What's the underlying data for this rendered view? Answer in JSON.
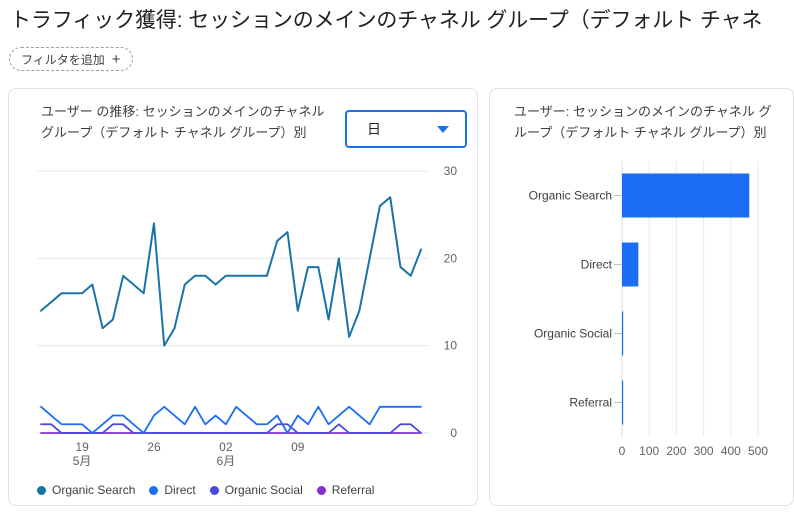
{
  "header": {
    "title": "トラフィック獲得: セッションのメインのチャネル グループ（デフォルト チャネ",
    "filter_chip_label": "フィルタを追加",
    "filter_chip_icon": "plus-icon"
  },
  "trend_card": {
    "title": "ユーザー の推移: セッションのメインのチャネル グループ（デフォルト チャネル グループ）別",
    "granularity": {
      "selected": "日",
      "icon": "chevron-down-icon"
    },
    "legend": [
      {
        "label": "Organic Search",
        "color": "#1a73a8"
      },
      {
        "label": "Direct",
        "color": "#1b6ef3"
      },
      {
        "label": "Organic Social",
        "color": "#4a46e0"
      },
      {
        "label": "Referral",
        "color": "#8430ce"
      }
    ]
  },
  "breakdown_card": {
    "title": "ユーザー: セッションのメインのチャネル グループ（デフォルト チャネル グループ）別"
  },
  "chart_data": [
    {
      "type": "line",
      "title": "ユーザー の推移: セッションのメインのチャネル グループ（デフォルト チャネル グループ）別",
      "xlabel": "",
      "ylabel": "",
      "ylim": [
        0,
        30
      ],
      "yticks": [
        0,
        10,
        20,
        30
      ],
      "grid": true,
      "legend_position": "bottom",
      "x_tick_labels": [
        {
          "index": 4,
          "line1": "19",
          "line2": "5月"
        },
        {
          "index": 11,
          "line1": "26",
          "line2": ""
        },
        {
          "index": 18,
          "line1": "02",
          "line2": "6月"
        },
        {
          "index": 25,
          "line1": "09",
          "line2": ""
        }
      ],
      "series": [
        {
          "name": "Organic Search",
          "color": "#1a73a8",
          "values": [
            14,
            15,
            16,
            16,
            16,
            17,
            12,
            13,
            18,
            17,
            16,
            24,
            10,
            12,
            17,
            18,
            18,
            17,
            18,
            18,
            18,
            18,
            18,
            22,
            23,
            14,
            19,
            19,
            13,
            20,
            11,
            14,
            20,
            26,
            27,
            19,
            18,
            21
          ]
        },
        {
          "name": "Direct",
          "color": "#1b6ef3",
          "values": [
            3,
            2,
            1,
            1,
            1,
            0,
            1,
            2,
            2,
            1,
            0,
            2,
            3,
            2,
            1,
            3,
            1,
            2,
            1,
            3,
            2,
            1,
            1,
            2,
            0,
            2,
            1,
            3,
            1,
            2,
            3,
            2,
            1,
            3,
            3,
            3,
            3,
            3
          ]
        },
        {
          "name": "Organic Social",
          "color": "#4a46e0",
          "values": [
            1,
            1,
            0,
            0,
            0,
            0,
            0,
            1,
            1,
            0,
            0,
            0,
            0,
            0,
            0,
            0,
            0,
            0,
            0,
            0,
            0,
            0,
            0,
            1,
            1,
            0,
            0,
            0,
            0,
            1,
            0,
            0,
            0,
            0,
            0,
            1,
            1,
            0
          ]
        },
        {
          "name": "Referral",
          "color": "#8430ce",
          "values": [
            0,
            0,
            0,
            0,
            0,
            0,
            0,
            0,
            0,
            0,
            0,
            0,
            0,
            0,
            0,
            0,
            0,
            0,
            0,
            0,
            0,
            0,
            0,
            0,
            0,
            0,
            0,
            0,
            0,
            0,
            0,
            0,
            0,
            0,
            0,
            0,
            0,
            0
          ]
        }
      ]
    },
    {
      "type": "bar",
      "orientation": "horizontal",
      "title": "ユーザー: セッションのメインのチャネル グループ（デフォルト チャネル グループ）別",
      "categories": [
        "Organic Search",
        "Direct",
        "Organic Social",
        "Referral"
      ],
      "values": [
        468,
        60,
        2,
        2
      ],
      "bar_color": "#1b6ef3",
      "xlabel": "",
      "ylabel": "",
      "xlim": [
        0,
        500
      ],
      "xticks": [
        0,
        100,
        200,
        300,
        400,
        500
      ],
      "grid": true
    }
  ]
}
